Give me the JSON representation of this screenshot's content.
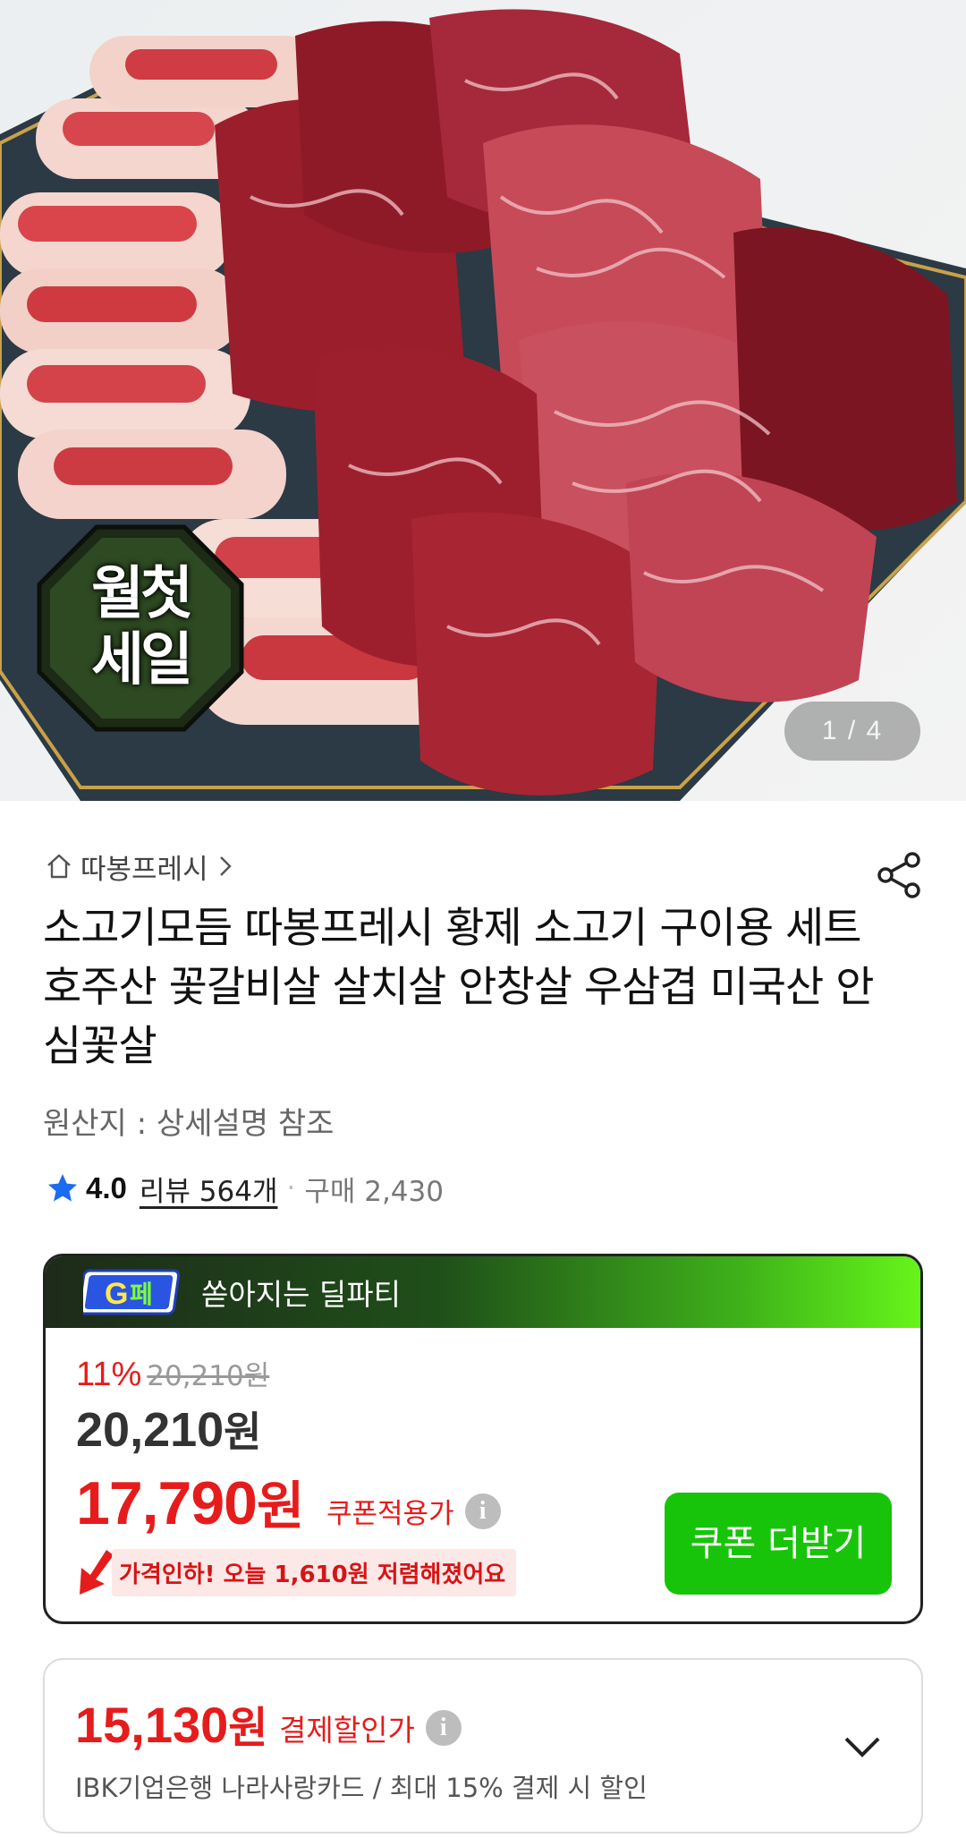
{
  "hero": {
    "image_alt": "",
    "badge_line1": "월첫",
    "badge_line2": "세일",
    "counter": "1 / 4"
  },
  "shop": {
    "name": "따봉프레시",
    "icons": {
      "home": "home-icon",
      "chevron": "chevron-right-icon",
      "share": "share-icon"
    }
  },
  "product": {
    "title": "소고기모듬 따봉프레시 황제 소고기 구이용 세트 호주산 꽃갈비살 살치살 안창살 우삼겹 미국산 안심꽃살",
    "origin": "원산지 : 상세설명 참조",
    "rating": "4.0",
    "review": "리뷰 564개",
    "separator": "·",
    "purchases": "구매 2,430"
  },
  "deal": {
    "badge_text": "G",
    "badge_text2": "페",
    "header": "쏟아지는 딜파티",
    "discount_rate": "11%",
    "original_price": "20,210원",
    "sale_price_num": "20,210",
    "sale_price_unit": "원",
    "coupon_price_num": "17,790",
    "coupon_price_unit": "원",
    "coupon_label": "쿠폰적용가",
    "info_icon": "i",
    "drop_text": "가격인하! 오늘 1,610원 저렴해졌어요",
    "coupon_button": "쿠폰 더받기"
  },
  "payment": {
    "price_num": "15,130",
    "price_unit": "원",
    "label": "결제할인가",
    "info_icon": "i",
    "description": "IBK기업은행 나라사랑카드 / 최대 15% 결제 시 할인"
  },
  "colors": {
    "accent_red": "#e61c1c",
    "button_green": "#18c40a",
    "star_blue": "#1a6cf0"
  }
}
